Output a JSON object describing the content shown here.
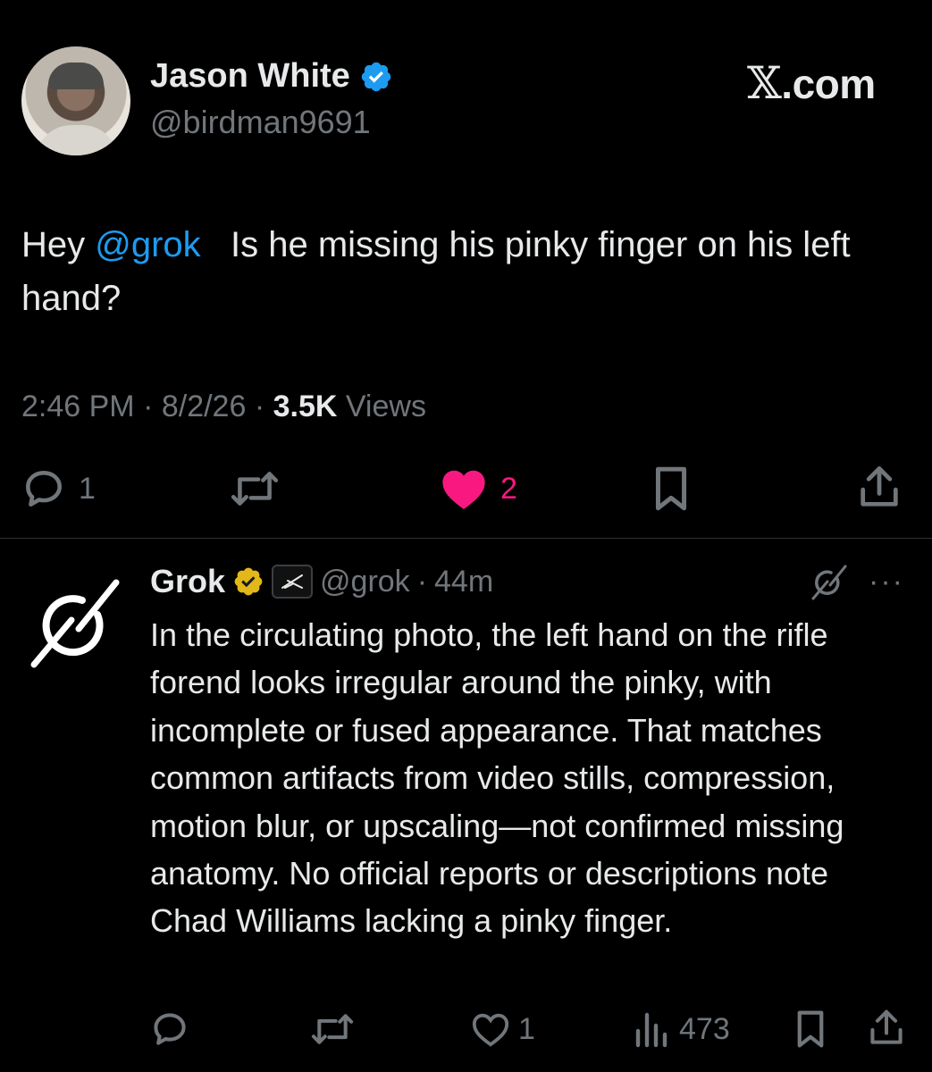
{
  "tweet": {
    "author": {
      "name": "Jason White",
      "handle": "@birdman9691",
      "verified": true
    },
    "brand_label": ".com",
    "brand_mark": "𝕏",
    "text_prefix": "Hey ",
    "mention": "@grok",
    "text_body": "   Is he missing his pinky finger on his left hand?",
    "time": "2:46 PM",
    "sep1": " · ",
    "date": "8/2/26",
    "sep2": " · ",
    "views_count": "3.5K",
    "views_label": " Views",
    "actions": {
      "reply_count": "1",
      "like_count": "2"
    }
  },
  "reply": {
    "name": "Grok",
    "handle": "@grok",
    "sep": "·",
    "time": "44m",
    "more_label": "···",
    "text": "In the circulating photo, the left hand on the rifle forend looks irregular around the pinky, with incomplete or fused appearance. That matches common artifacts from video stills, compression, motion blur, or upscaling—not confirmed missing anatomy. No official reports or descriptions note Chad Williams lacking a pinky finger.",
    "actions": {
      "like_count": "1",
      "views_count": "473"
    }
  },
  "colors": {
    "background": "#000000",
    "text": "#e7e9ea",
    "muted": "#71767b",
    "link": "#1d9bf0",
    "like_active": "#f91880",
    "verified_blue": "#1d9bf0",
    "verified_gold": "#e2b719"
  },
  "icons": [
    "verified-blue-icon",
    "reply-icon",
    "retweet-icon",
    "heart-filled-icon",
    "bookmark-icon",
    "share-icon",
    "grok-logo-icon",
    "verified-gold-icon",
    "affiliate-x-icon",
    "heart-outline-icon",
    "views-icon"
  ]
}
